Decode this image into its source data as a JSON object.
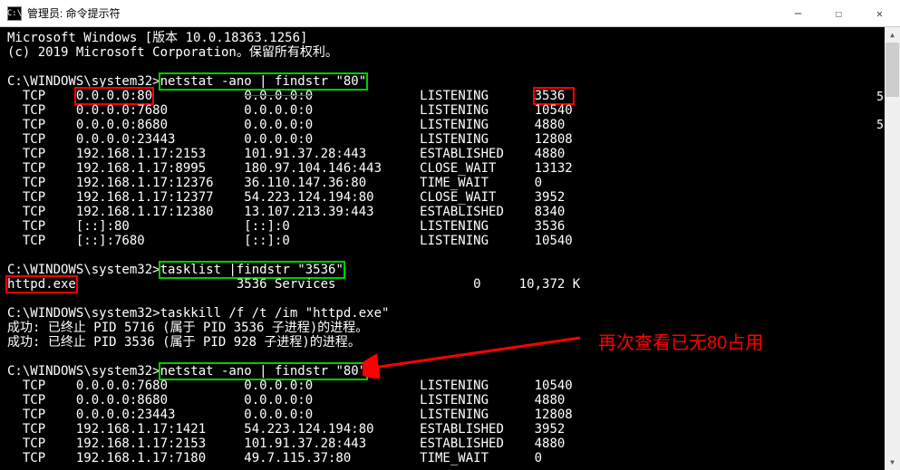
{
  "window": {
    "title": "管理员: 命令提示符",
    "icon_glyph": "C:\\"
  },
  "annotation": "再次查看已无80占用",
  "content": {
    "header1": "Microsoft Windows [版本 10.0.18363.1256]",
    "header2": "(c) 2019 Microsoft Corporation。保留所有权利。",
    "prompt_prefix": "C:\\WINDOWS\\system32>",
    "cmd1": "netstat -ano | findstr \"80\"",
    "rows1": [
      {
        "p": "TCP",
        "l": "0.0.0.0:80",
        "r": "0.0.0.0:0",
        "s": "LISTENING",
        "pid": "3536",
        "hl": "both",
        "strike": true
      },
      {
        "p": "TCP",
        "l": "0.0.0.0:7680",
        "r": "0.0.0.0:0",
        "s": "LISTENING",
        "pid": "10540"
      },
      {
        "p": "TCP",
        "l": "0.0.0.0:8680",
        "r": "0.0.0.0:0",
        "s": "LISTENING",
        "pid": "4880"
      },
      {
        "p": "TCP",
        "l": "0.0.0.0:23443",
        "r": "0.0.0.0:0",
        "s": "LISTENING",
        "pid": "12808"
      },
      {
        "p": "TCP",
        "l": "192.168.1.17:2153",
        "r": "101.91.37.28:443",
        "s": "ESTABLISHED",
        "pid": "4880"
      },
      {
        "p": "TCP",
        "l": "192.168.1.17:8995",
        "r": "180.97.104.146:443",
        "s": "CLOSE_WAIT",
        "pid": "13132"
      },
      {
        "p": "TCP",
        "l": "192.168.1.17:12376",
        "r": "36.110.147.36:80",
        "s": "TIME_WAIT",
        "pid": "0"
      },
      {
        "p": "TCP",
        "l": "192.168.1.17:12377",
        "r": "54.223.124.194:80",
        "s": "CLOSE_WAIT",
        "pid": "3952"
      },
      {
        "p": "TCP",
        "l": "192.168.1.17:12380",
        "r": "13.107.213.39:443",
        "s": "ESTABLISHED",
        "pid": "8340"
      },
      {
        "p": "TCP",
        "l": "[::]:80",
        "r": "[::]:0",
        "s": "LISTENING",
        "pid": "3536"
      },
      {
        "p": "TCP",
        "l": "[::]:7680",
        "r": "[::]:0",
        "s": "LISTENING",
        "pid": "10540"
      }
    ],
    "cmd2": "tasklist |findstr \"3536\"",
    "task_line": {
      "name": "httpd.exe",
      "pid": "3536",
      "stype": "Services",
      "snum": "0",
      "mem": "10,372 K"
    },
    "cmd3": "taskkill /f /t /im \"httpd.exe\"",
    "kill1": "成功: 已终止 PID 5716 (属于 PID 3536 子进程)的进程。",
    "kill2": "成功: 已终止 PID 3536 (属于 PID 928 子进程)的进程。",
    "cmd4": "netstat -ano | findstr \"80\"",
    "rows2": [
      {
        "p": "TCP",
        "l": "0.0.0.0:7680",
        "r": "0.0.0.0:0",
        "s": "LISTENING",
        "pid": "10540"
      },
      {
        "p": "TCP",
        "l": "0.0.0.0:8680",
        "r": "0.0.0.0:0",
        "s": "LISTENING",
        "pid": "4880"
      },
      {
        "p": "TCP",
        "l": "0.0.0.0:23443",
        "r": "0.0.0.0:0",
        "s": "LISTENING",
        "pid": "12808"
      },
      {
        "p": "TCP",
        "l": "192.168.1.17:1421",
        "r": "54.223.124.194:80",
        "s": "ESTABLISHED",
        "pid": "3952"
      },
      {
        "p": "TCP",
        "l": "192.168.1.17:2153",
        "r": "101.91.37.28:443",
        "s": "ESTABLISHED",
        "pid": "4880"
      },
      {
        "p": "TCP",
        "l": "192.168.1.17:7180",
        "r": "49.7.115.37:80",
        "s": "TIME_WAIT",
        "pid": "0"
      }
    ]
  }
}
